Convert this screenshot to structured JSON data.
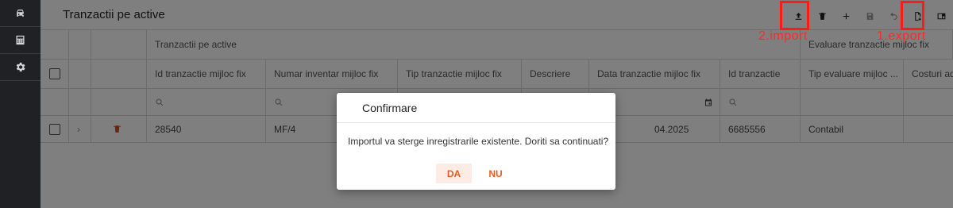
{
  "sidebar": {
    "items": [
      {
        "icon": "car-icon"
      },
      {
        "icon": "calculator-icon"
      },
      {
        "icon": "gear-icon"
      }
    ]
  },
  "header": {
    "title": "Tranzactii pe active"
  },
  "toolbar": {
    "buttons": [
      {
        "icon": "upload-icon",
        "name": "import"
      },
      {
        "icon": "trash-icon",
        "name": "delete"
      },
      {
        "icon": "plus-icon",
        "name": "add"
      },
      {
        "icon": "save-icon",
        "name": "save",
        "disabled": true
      },
      {
        "icon": "undo-icon",
        "name": "undo",
        "disabled": true
      },
      {
        "icon": "export-file-icon",
        "name": "export"
      },
      {
        "icon": "window-icon",
        "name": "layout"
      }
    ]
  },
  "annotations": {
    "import_label": "2.import",
    "export_label": "1.export",
    "color": "#ff1a1a"
  },
  "table": {
    "group_headers": [
      "Tranzactii pe active",
      "Evaluare tranzactie mijloc fix"
    ],
    "columns": [
      "Id tranzactie mijloc fix",
      "Numar inventar mijloc fix",
      "Tip tranzactie mijloc fix",
      "Descriere",
      "Data tranzactie mijloc fix",
      "Id tranzactie",
      "Tip evaluare mijloc ...",
      "Costuri ad"
    ],
    "rows": [
      {
        "cells": [
          "28540",
          "MF/4",
          "",
          "",
          "04.2025",
          "6685556",
          "Contabil",
          ""
        ]
      }
    ]
  },
  "dialog": {
    "title": "Confirmare",
    "message": "Importul va sterge inregistrarile existente. Doriti sa continuati?",
    "confirm_label": "DA",
    "cancel_label": "NU",
    "accent": "#e65a24"
  }
}
